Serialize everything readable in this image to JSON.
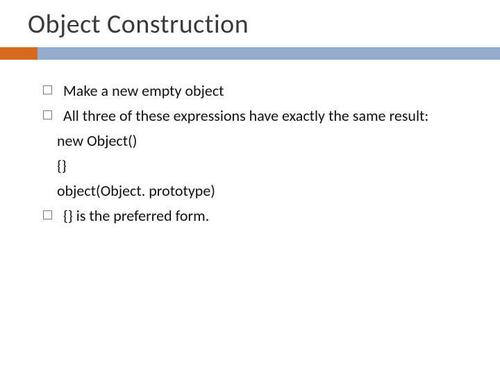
{
  "title": "Object Construction",
  "bullets": {
    "b1": "Make a new empty object",
    "b2": "All three of these expressions have exactly the same result:",
    "b3": "{}  is the preferred form."
  },
  "code": {
    "l1": "new Object()",
    "l2": "{}",
    "l3": "object(Object. prototype)"
  }
}
